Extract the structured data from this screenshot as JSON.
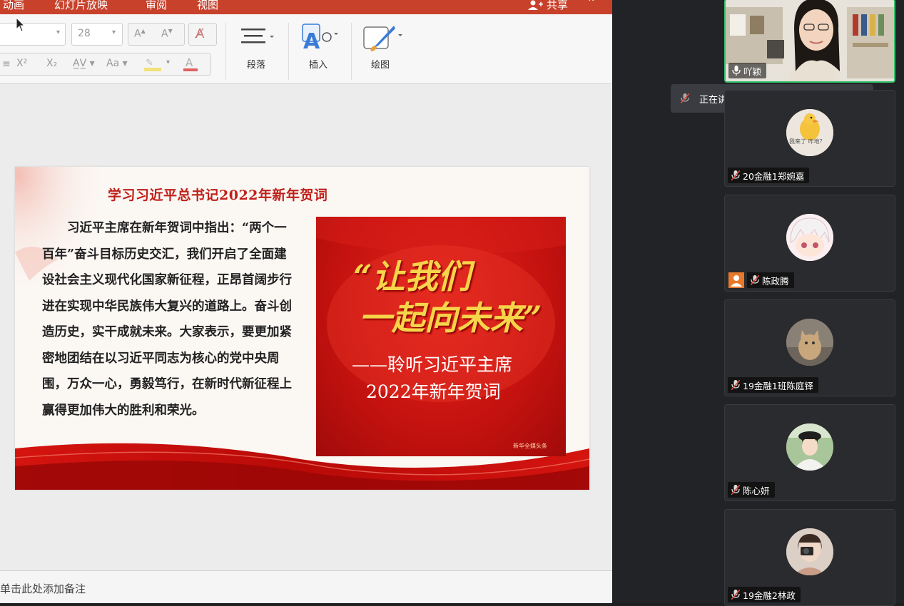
{
  "menubar": {
    "items": [
      "动画",
      "幻灯片放映",
      "审阅",
      "视图"
    ],
    "share_label": "共享",
    "color": "#c8412b"
  },
  "ribbon": {
    "font_size": "28",
    "superscript": "X²",
    "subscript": "X₂",
    "paragraph_label": "段落",
    "insert_label": "插入",
    "draw_label": "绘图"
  },
  "slide": {
    "title": "学习习近平总书记2022年新年贺词",
    "body": "习近平主席在新年贺词中指出：“两个一百年”奋斗目标历史交汇，我们开启了全面建设社会主义现代化国家新征程，正昂首阔步行进在实现中华民族伟大复兴的道路上。奋斗创造历史，实干成就未来。大家表示，要更加紧密地团结在以习近平同志为核心的党中央周围，万众一心，勇毅笃行，在新时代新征程上赢得更加伟大的胜利和荣光。",
    "image": {
      "slogan_line1": "“让我们",
      "slogan_line2": "一起向未来”",
      "subtitle_line1": "——聆听习近平主席",
      "subtitle_line2": "2022年新年贺词",
      "source": "新华全媒头条"
    }
  },
  "notes": {
    "placeholder": "单击此处添加备注"
  },
  "meeting": {
    "speaking_toast": "正在讲话: 吖颖;",
    "participants": [
      {
        "name": "吖颖",
        "muted": false,
        "video": true
      },
      {
        "name": "20金融1郑婉嘉",
        "muted": true,
        "avatar_caption": "我来了 咋地？"
      },
      {
        "name": "陈政腾",
        "muted": true
      },
      {
        "name": "19金融1班陈庭铎",
        "muted": true
      },
      {
        "name": "陈心妍",
        "muted": true
      },
      {
        "name": "19金融2林政",
        "muted": true
      }
    ]
  }
}
